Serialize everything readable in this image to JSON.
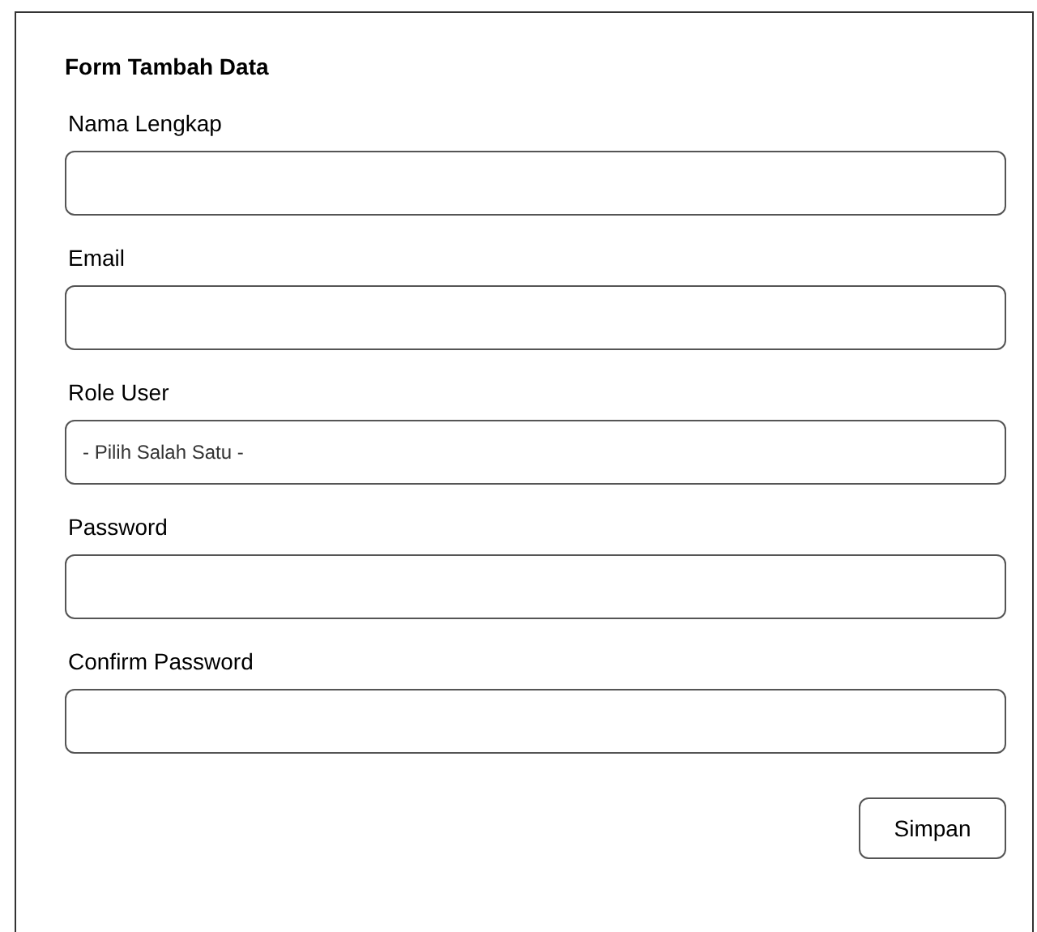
{
  "form": {
    "title": "Form Tambah Data",
    "fields": [
      {
        "label": "Nama Lengkap",
        "kind": "text"
      },
      {
        "label": "Email",
        "kind": "text"
      },
      {
        "label": "Role User",
        "kind": "select",
        "value": "- Pilih Salah Satu -"
      },
      {
        "label": "Password",
        "kind": "password"
      },
      {
        "label": "Confirm Password",
        "kind": "password"
      }
    ],
    "submit": "Simpan"
  }
}
